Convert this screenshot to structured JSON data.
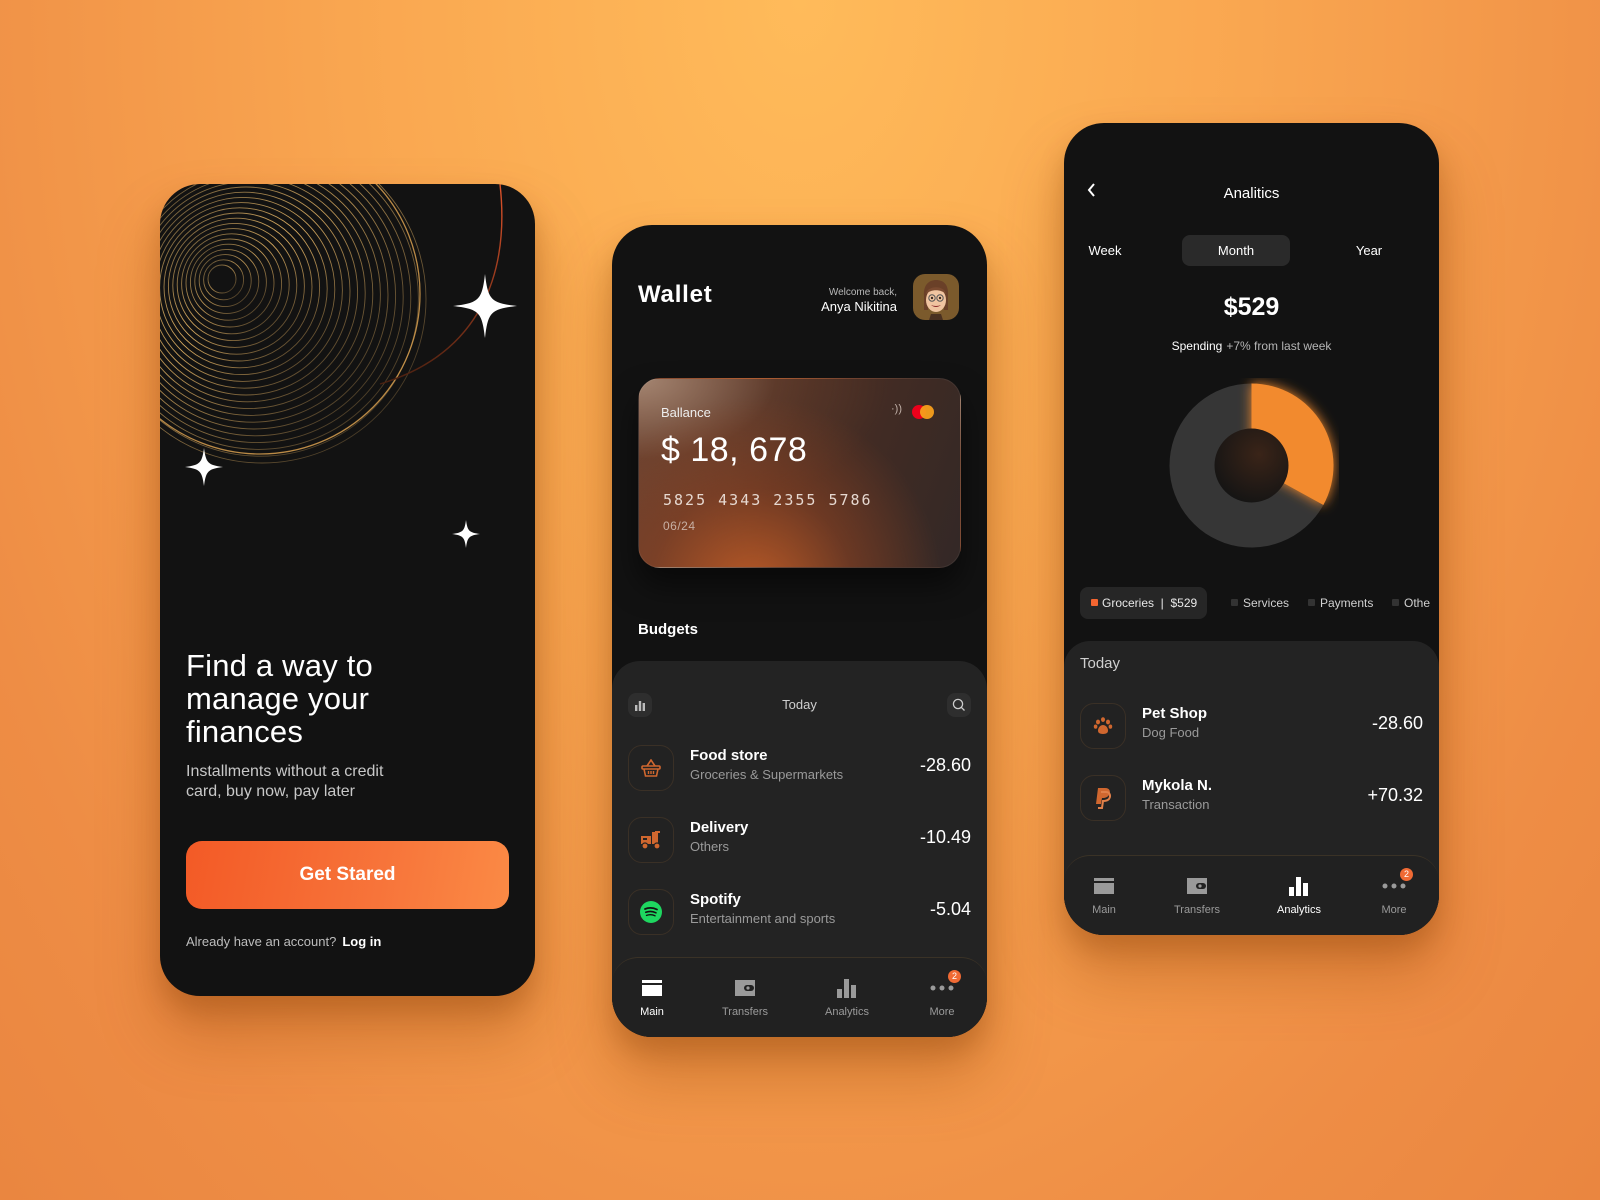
{
  "onboarding": {
    "headline": "Find a way to manage your finances",
    "subtitle": "Installments without a credit card, buy now, pay later",
    "cta_label": "Get Stared",
    "login_prompt": "Already have an account?",
    "login_link": "Log in"
  },
  "wallet": {
    "title": "Wallet",
    "welcome_small": "Welcome back,",
    "user_name": "Anya Nikitina",
    "card": {
      "label": "Ballance",
      "balance": "$ 18, 678",
      "number": "5825 4343 2355 5786",
      "expiry": "06/24"
    },
    "budgets_label": "Budgets",
    "period_label": "Today",
    "transactions": [
      {
        "title": "Food store",
        "subtitle": "Groceries & Supermarkets",
        "amount": "-28.60",
        "icon": "basket-icon"
      },
      {
        "title": "Delivery",
        "subtitle": "Others",
        "amount": "-10.49",
        "icon": "delivery-truck-icon"
      },
      {
        "title": "Spotify",
        "subtitle": "Entertainment and sports",
        "amount": "-5.04",
        "icon": "spotify-icon"
      }
    ],
    "tabs": [
      {
        "label": "Main",
        "icon": "card-icon",
        "active": true
      },
      {
        "label": "Transfers",
        "icon": "wallet-icon",
        "active": false
      },
      {
        "label": "Analytics",
        "icon": "bar-chart-icon",
        "active": false
      },
      {
        "label": "More",
        "icon": "more-dots-icon",
        "active": false,
        "badge": "2"
      }
    ]
  },
  "analytics": {
    "title": "Analitics",
    "segments": [
      {
        "label": "Week",
        "active": false
      },
      {
        "label": "Month",
        "active": true
      },
      {
        "label": "Year",
        "active": false
      }
    ],
    "amount": "$529",
    "spending_label": "Spending",
    "change_text": "+7% from last week",
    "legend": [
      {
        "label": "Groceries  |  $529",
        "active": true
      },
      {
        "label": "Services",
        "active": false
      },
      {
        "label": "Payments",
        "active": false
      },
      {
        "label": "Othe",
        "active": false
      }
    ],
    "today_label": "Today",
    "transactions": [
      {
        "title": "Pet Shop",
        "subtitle": "Dog Food",
        "amount": "-28.60",
        "icon": "paw-icon"
      },
      {
        "title": "Mykola N.",
        "subtitle": "Transaction",
        "amount": "+70.32",
        "icon": "paypal-icon"
      }
    ],
    "tabs": [
      {
        "label": "Main",
        "icon": "card-icon",
        "active": false
      },
      {
        "label": "Transfers",
        "icon": "wallet-icon",
        "active": false
      },
      {
        "label": "Analytics",
        "icon": "bar-chart-icon",
        "active": true
      },
      {
        "label": "More",
        "icon": "more-dots-icon",
        "active": false,
        "badge": "2"
      }
    ],
    "chart_data": {
      "type": "pie",
      "style": "donut",
      "categories": [
        "Groceries",
        "Other"
      ],
      "values": [
        0.33,
        0.67
      ],
      "colors": [
        "#f28a2e",
        "#363636"
      ]
    }
  },
  "colors": {
    "accent": "#f46530",
    "phone_bg": "#121212",
    "sheet_bg": "#232323"
  }
}
